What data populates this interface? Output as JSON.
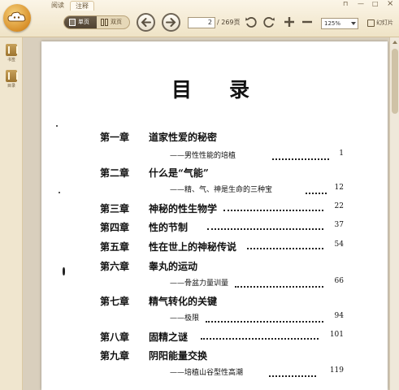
{
  "menu": {
    "read": "阅读",
    "annotate": "注释"
  },
  "window_controls": {
    "pin": "⊓",
    "minimize": "—",
    "maximize": "□",
    "close": "×"
  },
  "toolbar": {
    "single_page": "单页",
    "double_page": "双页",
    "current_page": "2",
    "total_pages": "/ 269页",
    "zoom": "125%",
    "slideshow": "幻灯片"
  },
  "sidebar": {
    "bookmarks": "书签",
    "contents": "目录"
  },
  "colors": {
    "chrome": "#f3ead7",
    "accent": "#d8902a",
    "page": "#ffffff"
  },
  "document": {
    "title": "目录",
    "entries": [
      {
        "chapter": "第一章",
        "title": "道家性爱的秘密",
        "subtitle": "——男性性能的培植",
        "page": "1"
      },
      {
        "chapter": "第二章",
        "title": "什么是“气能”",
        "subtitle": "——精、气、神是生命的三种宝",
        "page": "12"
      },
      {
        "chapter": "第三章",
        "title": "神秘的性生物学",
        "subtitle": "",
        "page": "22"
      },
      {
        "chapter": "第四章",
        "title": "性的节制",
        "subtitle": "",
        "page": "37"
      },
      {
        "chapter": "第五章",
        "title": "性在世上的神秘传说",
        "subtitle": "",
        "page": "54"
      },
      {
        "chapter": "第六章",
        "title": "睾丸的运动",
        "subtitle": "——骨盆力量训量",
        "page": "66"
      },
      {
        "chapter": "第七章",
        "title": "精气转化的关键",
        "subtitle": "——极限",
        "page": "94"
      },
      {
        "chapter": "第八章",
        "title": "固精之谜",
        "subtitle": "",
        "page": "101"
      },
      {
        "chapter": "第九章",
        "title": "阴阳能量交换",
        "subtitle": "——培植山谷型性高潮",
        "page": "119"
      }
    ]
  }
}
